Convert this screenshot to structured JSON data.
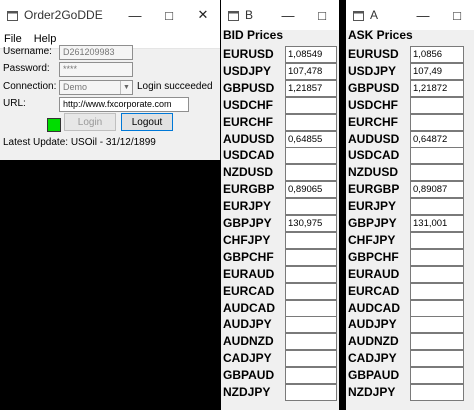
{
  "main_window": {
    "title": "Order2GoDDE",
    "menu": [
      "File",
      "Help"
    ],
    "username_label": "Username:",
    "username_value": "D261209983",
    "password_label": "Password:",
    "password_value": "****",
    "connection_label": "Connection:",
    "connection_value": "Demo",
    "login_status": "Login succeeded",
    "url_label": "URL:",
    "url_value": "http://www.fxcorporate.com",
    "status_color": "#00dd00",
    "login_label": "Login",
    "logout_label": "Logout",
    "latest_update": "Latest Update: USOil - 31/12/1899"
  },
  "bid_window": {
    "title": "B",
    "header": "BID Prices",
    "rows": [
      {
        "symbol": "EURUSD",
        "value": "1,08549"
      },
      {
        "symbol": "USDJPY",
        "value": "107,478"
      },
      {
        "symbol": "GBPUSD",
        "value": "1,21857"
      },
      {
        "symbol": "USDCHF",
        "value": ""
      },
      {
        "symbol": "EURCHF",
        "value": ""
      },
      {
        "symbol": "AUDUSD",
        "value": "0,64855"
      },
      {
        "symbol": "USDCAD",
        "value": ""
      },
      {
        "symbol": "NZDUSD",
        "value": ""
      },
      {
        "symbol": "EURGBP",
        "value": "0,89065"
      },
      {
        "symbol": "EURJPY",
        "value": ""
      },
      {
        "symbol": "GBPJPY",
        "value": "130,975"
      },
      {
        "symbol": "CHFJPY",
        "value": ""
      },
      {
        "symbol": "GBPCHF",
        "value": ""
      },
      {
        "symbol": "EURAUD",
        "value": ""
      },
      {
        "symbol": "EURCAD",
        "value": ""
      },
      {
        "symbol": "AUDCAD",
        "value": ""
      },
      {
        "symbol": "AUDJPY",
        "value": ""
      },
      {
        "symbol": "AUDNZD",
        "value": ""
      },
      {
        "symbol": "CADJPY",
        "value": ""
      },
      {
        "symbol": "GBPAUD",
        "value": ""
      },
      {
        "symbol": "NZDJPY",
        "value": ""
      }
    ]
  },
  "ask_window": {
    "title": "A",
    "header": "ASK Prices",
    "rows": [
      {
        "symbol": "EURUSD",
        "value": "1,0856"
      },
      {
        "symbol": "USDJPY",
        "value": "107,49"
      },
      {
        "symbol": "GBPUSD",
        "value": "1,21872"
      },
      {
        "symbol": "USDCHF",
        "value": ""
      },
      {
        "symbol": "EURCHF",
        "value": ""
      },
      {
        "symbol": "AUDUSD",
        "value": "0,64872"
      },
      {
        "symbol": "USDCAD",
        "value": ""
      },
      {
        "symbol": "NZDUSD",
        "value": ""
      },
      {
        "symbol": "EURGBP",
        "value": "0,89087"
      },
      {
        "symbol": "EURJPY",
        "value": ""
      },
      {
        "symbol": "GBPJPY",
        "value": "131,001"
      },
      {
        "symbol": "CHFJPY",
        "value": ""
      },
      {
        "symbol": "GBPCHF",
        "value": ""
      },
      {
        "symbol": "EURAUD",
        "value": ""
      },
      {
        "symbol": "EURCAD",
        "value": ""
      },
      {
        "symbol": "AUDCAD",
        "value": ""
      },
      {
        "symbol": "AUDJPY",
        "value": ""
      },
      {
        "symbol": "AUDNZD",
        "value": ""
      },
      {
        "symbol": "CADJPY",
        "value": ""
      },
      {
        "symbol": "GBPAUD",
        "value": ""
      },
      {
        "symbol": "NZDJPY",
        "value": ""
      }
    ]
  }
}
